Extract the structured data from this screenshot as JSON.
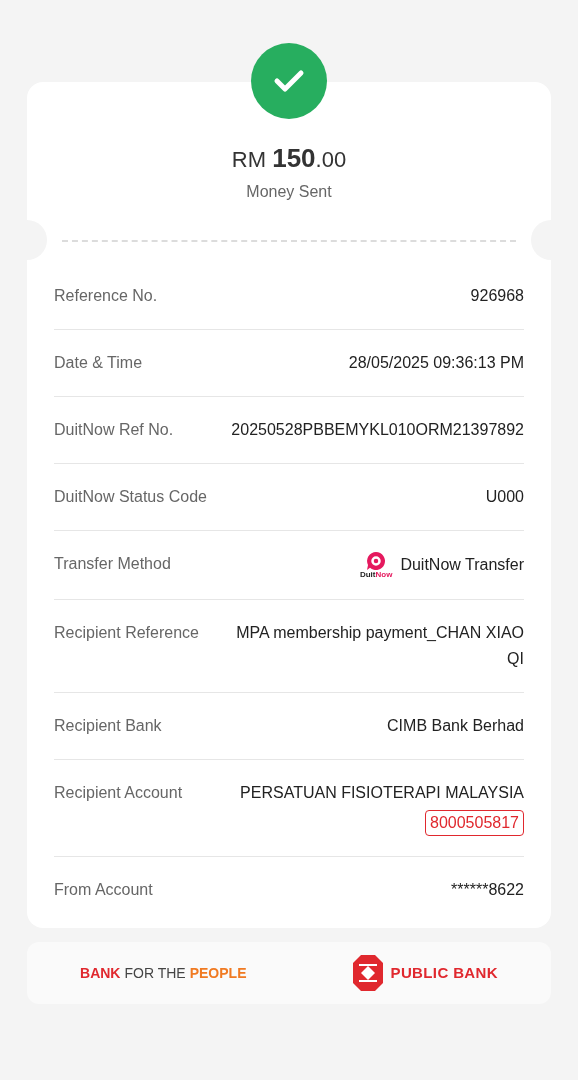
{
  "amount": {
    "currency": "RM",
    "whole": "150",
    "decimals": ".00"
  },
  "status": "Money Sent",
  "rows": [
    {
      "kind": "text",
      "label": "Reference No.",
      "value": "926968"
    },
    {
      "kind": "text",
      "label": "Date & Time",
      "value": "28/05/2025 09:36:13 PM"
    },
    {
      "kind": "text",
      "label": "DuitNow Ref No.",
      "value": "20250528PBBEMYKL010ORM21397892"
    },
    {
      "kind": "text",
      "label": "DuitNow Status Code",
      "value": "U000"
    },
    {
      "kind": "method",
      "label": "Transfer Method",
      "value": "DuitNow Transfer",
      "logo_text": [
        "Duit",
        "Now"
      ]
    },
    {
      "kind": "text",
      "label": "Recipient Reference",
      "value": "MPA membership payment_CHAN XIAO QI"
    },
    {
      "kind": "text",
      "label": "Recipient Bank",
      "value": "CIMB Bank Berhad"
    },
    {
      "kind": "account",
      "label": "Recipient Account",
      "value": "PERSATUAN FISIOTERAPI MALAYSIA",
      "account": "8000505817"
    },
    {
      "kind": "text",
      "label": "From Account",
      "value": "******8622"
    }
  ],
  "footer": {
    "slogan": [
      {
        "text": "BANK",
        "color": "#e0282e"
      },
      {
        "text": "FOR THE",
        "color": "#444444"
      },
      {
        "text": "PEOPLE",
        "color": "#f07a22"
      }
    ],
    "bank_name": "PUBLIC BANK"
  }
}
